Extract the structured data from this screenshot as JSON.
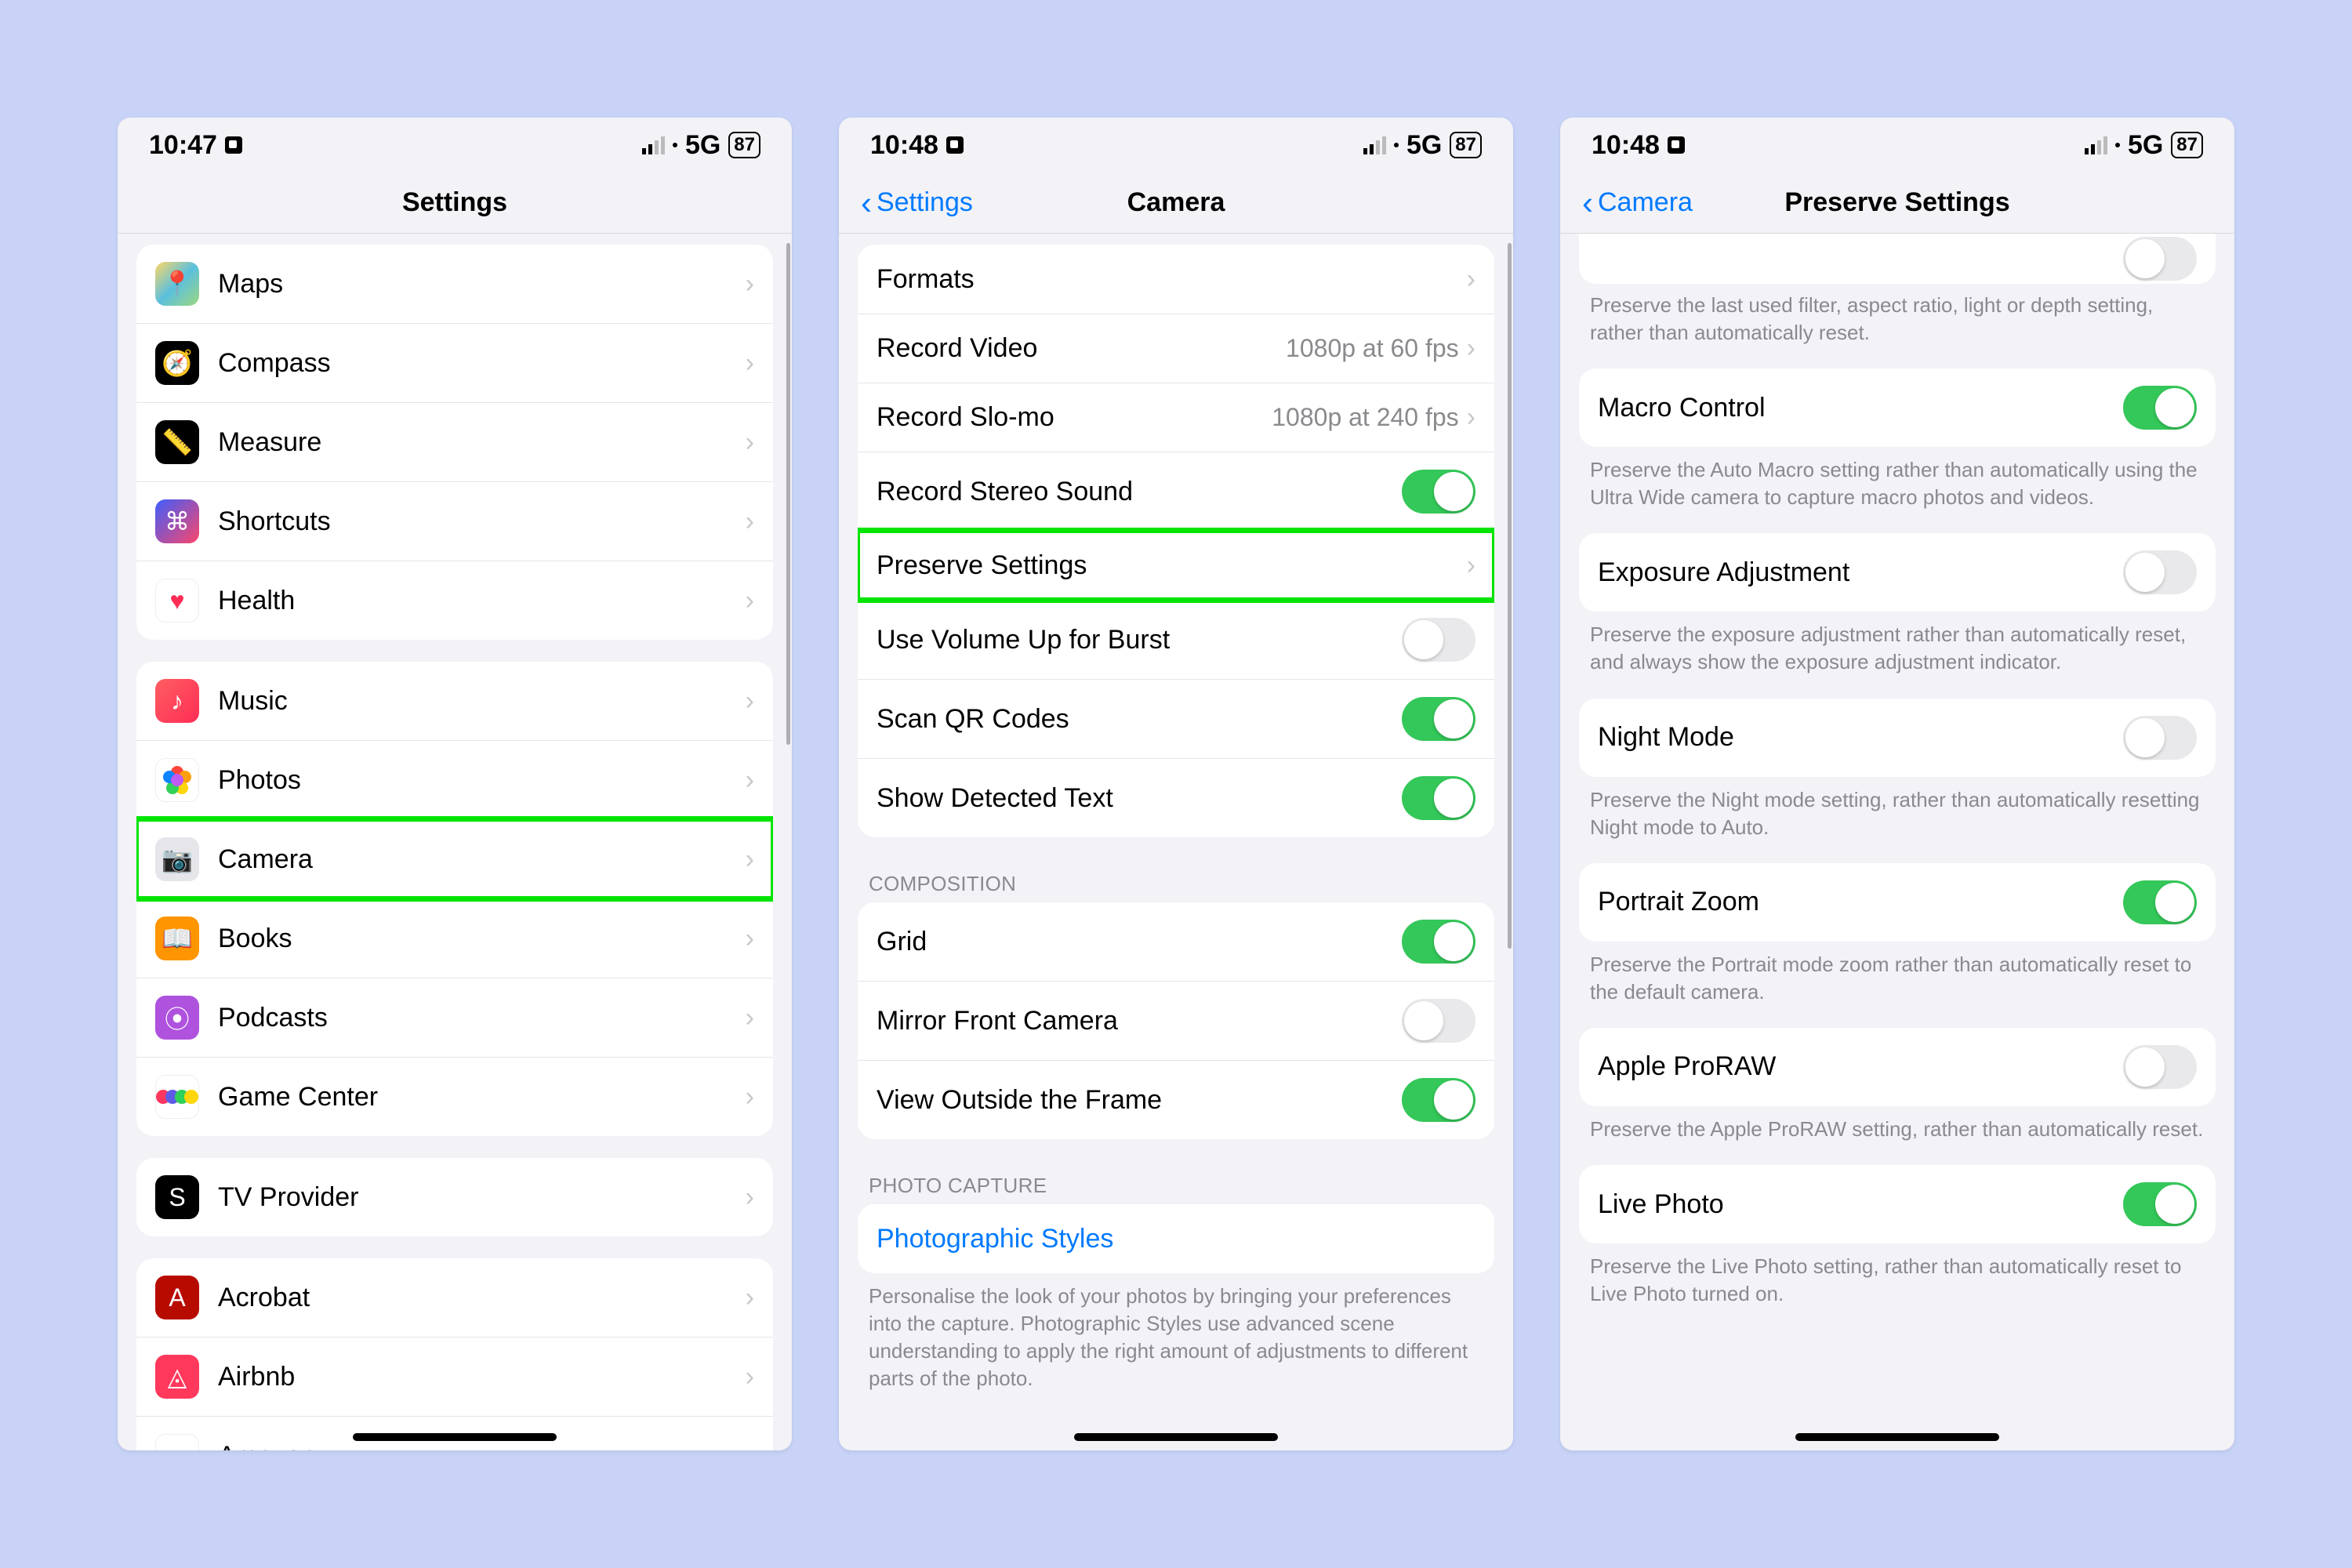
{
  "status": {
    "time1": "10:47",
    "time2": "10:48",
    "time3": "10:48",
    "network": "5G",
    "battery": "87"
  },
  "phone1": {
    "title": "Settings",
    "groups": [
      {
        "items": [
          {
            "icon": "maps-icon",
            "label": "Maps"
          },
          {
            "icon": "compass-icon",
            "label": "Compass"
          },
          {
            "icon": "measure-icon",
            "label": "Measure"
          },
          {
            "icon": "shortcuts-icon",
            "label": "Shortcuts"
          },
          {
            "icon": "health-icon",
            "label": "Health"
          }
        ]
      },
      {
        "items": [
          {
            "icon": "music-icon",
            "label": "Music"
          },
          {
            "icon": "photos-icon",
            "label": "Photos"
          },
          {
            "icon": "camera-icon",
            "label": "Camera",
            "highlight": true
          },
          {
            "icon": "books-icon",
            "label": "Books"
          },
          {
            "icon": "podcasts-icon",
            "label": "Podcasts"
          },
          {
            "icon": "gamecenter-icon",
            "label": "Game Center"
          }
        ]
      },
      {
        "items": [
          {
            "icon": "tvprovider-icon",
            "label": "TV Provider"
          }
        ]
      },
      {
        "items": [
          {
            "icon": "acrobat-icon",
            "label": "Acrobat"
          },
          {
            "icon": "airbnb-icon",
            "label": "Airbnb"
          },
          {
            "icon": "amazon-icon",
            "label": "Amazon"
          }
        ]
      }
    ]
  },
  "phone2": {
    "back": "Settings",
    "title": "Camera",
    "groups": [
      {
        "items": [
          {
            "label": "Formats",
            "type": "nav"
          },
          {
            "label": "Record Video",
            "value": "1080p at 60 fps",
            "type": "nav"
          },
          {
            "label": "Record Slo-mo",
            "value": "1080p at 240 fps",
            "type": "nav"
          },
          {
            "label": "Record Stereo Sound",
            "type": "toggle",
            "on": true
          },
          {
            "label": "Preserve Settings",
            "type": "nav",
            "highlight": true
          },
          {
            "label": "Use Volume Up for Burst",
            "type": "toggle",
            "on": false
          },
          {
            "label": "Scan QR Codes",
            "type": "toggle",
            "on": true
          },
          {
            "label": "Show Detected Text",
            "type": "toggle",
            "on": true
          }
        ]
      },
      {
        "header": "COMPOSITION",
        "items": [
          {
            "label": "Grid",
            "type": "toggle",
            "on": true
          },
          {
            "label": "Mirror Front Camera",
            "type": "toggle",
            "on": false
          },
          {
            "label": "View Outside the Frame",
            "type": "toggle",
            "on": true
          }
        ]
      },
      {
        "header": "PHOTO CAPTURE",
        "items": [
          {
            "label": "Photographic Styles",
            "type": "link"
          }
        ],
        "footer": "Personalise the look of your photos by bringing your preferences into the capture. Photographic Styles use advanced scene understanding to apply the right amount of adjustments to different parts of the photo."
      }
    ]
  },
  "phone3": {
    "back": "Camera",
    "title": "Preserve Settings",
    "topFooter": "Preserve the last used filter, aspect ratio, light or depth setting, rather than automatically reset.",
    "groups": [
      {
        "items": [
          {
            "label": "Macro Control",
            "type": "toggle",
            "on": true
          }
        ],
        "footer": "Preserve the Auto Macro setting rather than automatically using the Ultra Wide camera to capture macro photos and videos."
      },
      {
        "items": [
          {
            "label": "Exposure Adjustment",
            "type": "toggle",
            "on": false
          }
        ],
        "footer": "Preserve the exposure adjustment rather than automatically reset, and always show the exposure adjustment indicator."
      },
      {
        "items": [
          {
            "label": "Night Mode",
            "type": "toggle",
            "on": false
          }
        ],
        "footer": "Preserve the Night mode setting, rather than automatically resetting Night mode to Auto."
      },
      {
        "items": [
          {
            "label": "Portrait Zoom",
            "type": "toggle",
            "on": true
          }
        ],
        "footer": "Preserve the Portrait mode zoom rather than automatically reset to the default camera."
      },
      {
        "items": [
          {
            "label": "Apple ProRAW",
            "type": "toggle",
            "on": false
          }
        ],
        "footer": "Preserve the Apple ProRAW setting, rather than automatically reset."
      },
      {
        "items": [
          {
            "label": "Live Photo",
            "type": "toggle",
            "on": true
          }
        ],
        "footer": "Preserve the Live Photo setting, rather than automatically reset to Live Photo turned on."
      }
    ]
  }
}
